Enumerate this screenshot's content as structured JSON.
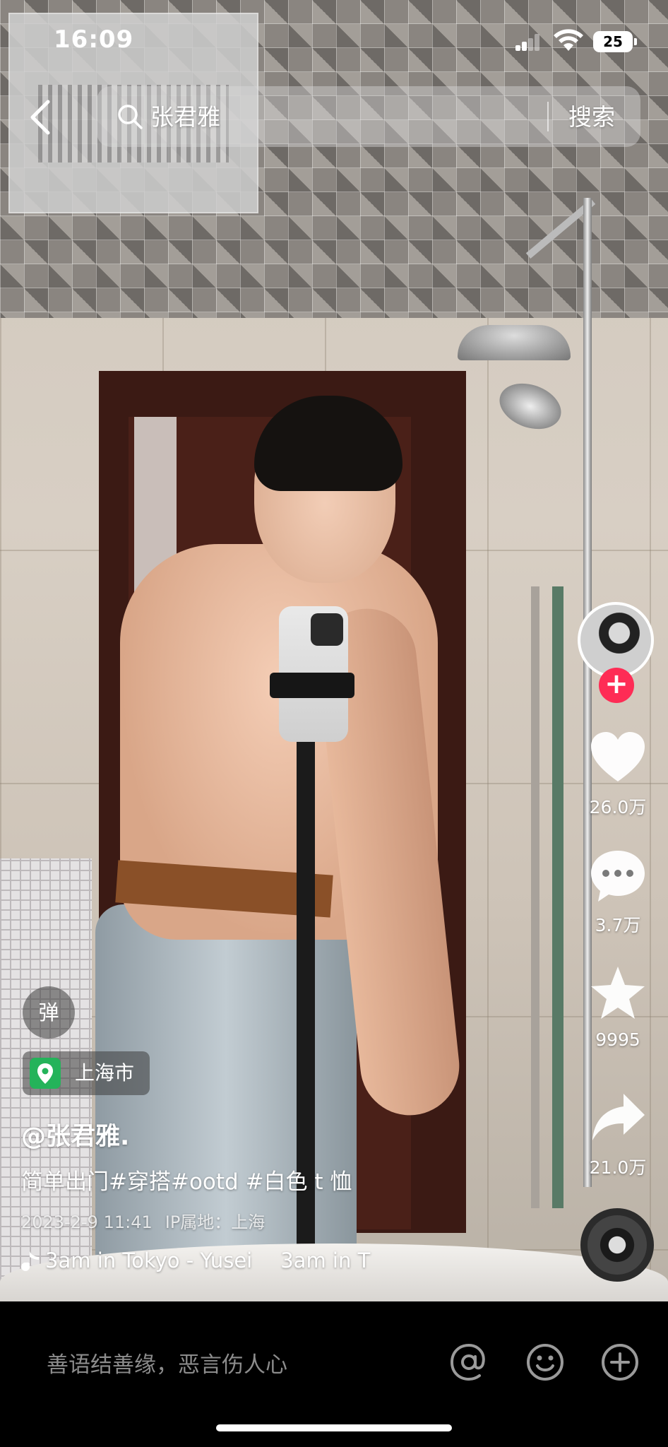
{
  "status_bar": {
    "time": "16:09",
    "battery": "25"
  },
  "search": {
    "query": "张君雅",
    "button_label": "搜索"
  },
  "rail": {
    "like_count": "26.0万",
    "comment_count": "3.7万",
    "favorite_count": "9995",
    "share_count": "21.0万",
    "follow_symbol": "+"
  },
  "overlay": {
    "danmaku_label": "弹",
    "location": "上海市",
    "author": "@张君雅.",
    "caption": "简单出门#穿搭#ootd #白色 t 恤",
    "date": "2023-2-9 11:41",
    "ip_location": "IP属地：上海",
    "music_title": "3am in Tokyo - Yusei",
    "music_title_repeat": "3am in T"
  },
  "comment_bar": {
    "placeholder": "善语结善缘，恶言伤人心"
  },
  "colors": {
    "follow_accent": "#fe2c55",
    "location_green": "#24b35a",
    "background": "#000000"
  }
}
